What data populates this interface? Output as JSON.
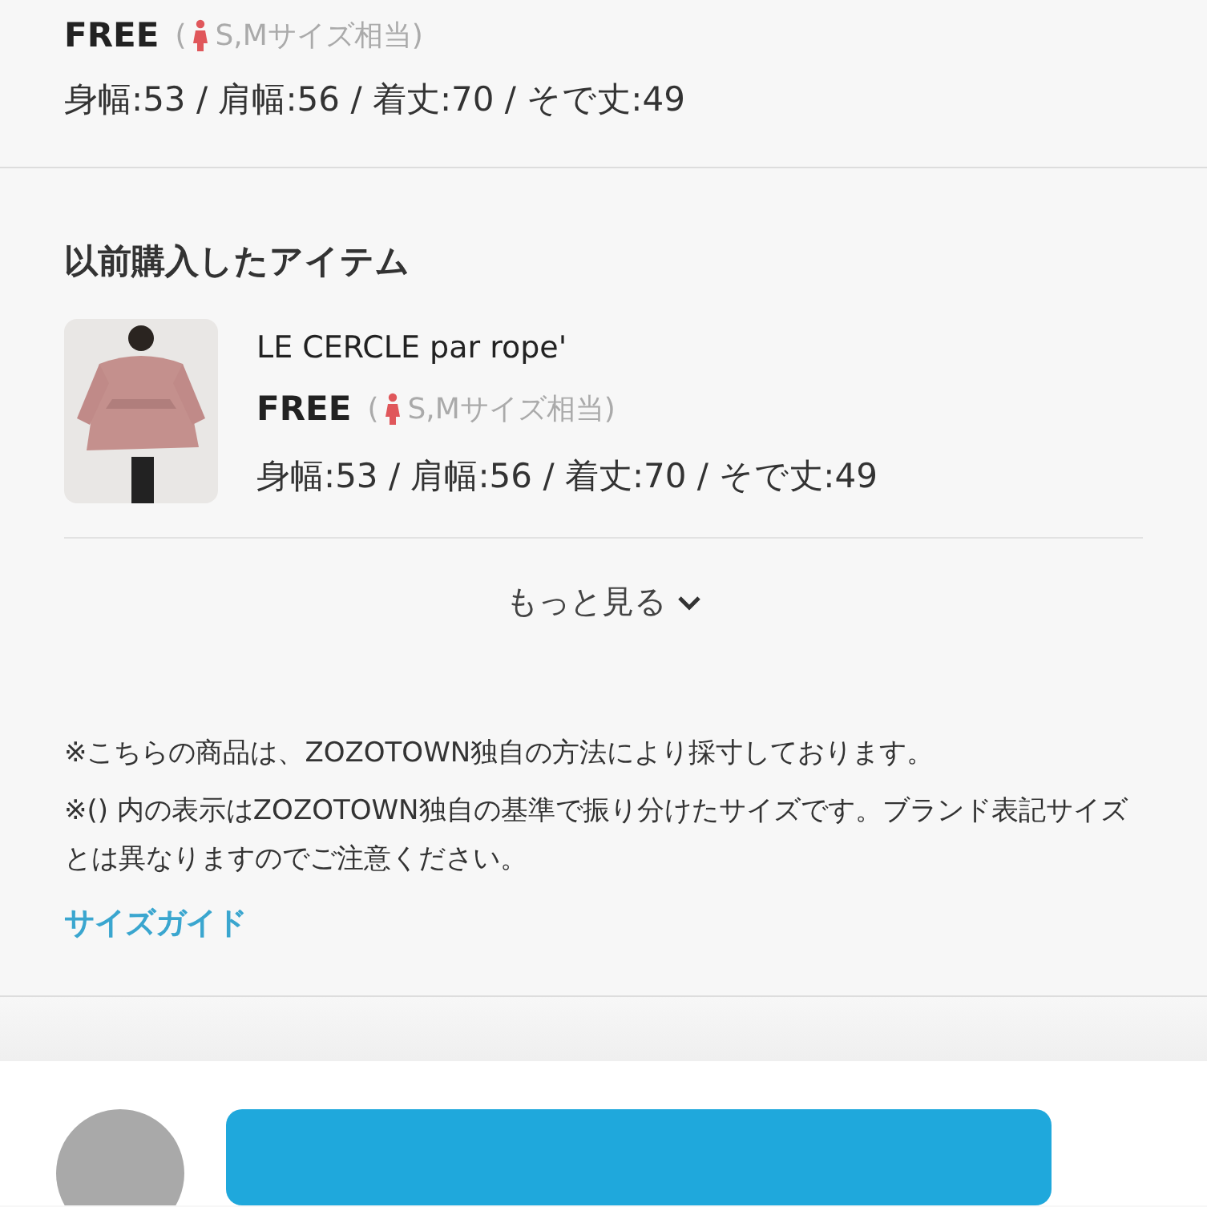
{
  "current_size": {
    "size": "FREE",
    "open_paren": "(",
    "equivalent": "S,Mサイズ相当)",
    "measurements": "身幅:53 / 肩幅:56 / 着丈:70 / そで丈:49"
  },
  "previous_items": {
    "title": "以前購入したアイテム",
    "items": [
      {
        "brand": "LE CERCLE par rope'",
        "size": "FREE",
        "open_paren": "(",
        "equivalent": "S,Mサイズ相当)",
        "measurements": "身幅:53 / 肩幅:56 / 着丈:70 / そで丈:49"
      }
    ],
    "more": "もっと見る"
  },
  "notes": [
    "※こちらの商品は、ZOZOTOWN独自の方法により採寸しております。",
    "※() 内の表示はZOZOTOWN独自の基準で振り分けたサイズです。ブランド表記サイズとは異なりますのでご注意ください。"
  ],
  "size_guide_link": "サイズガイド"
}
